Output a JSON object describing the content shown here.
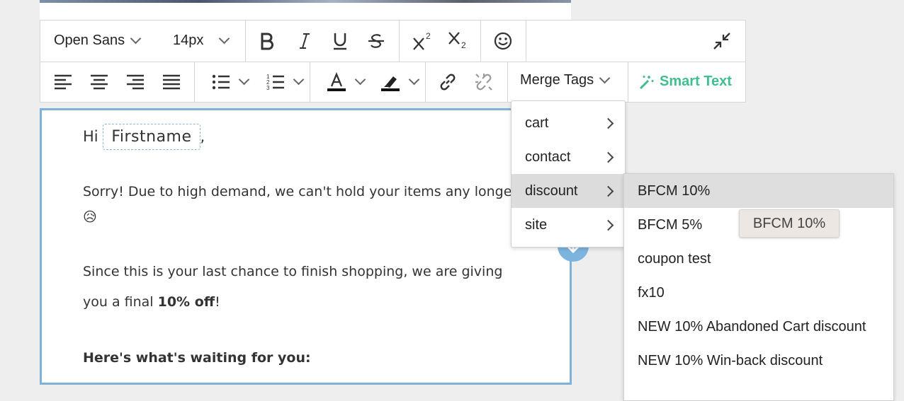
{
  "toolbar": {
    "font_family": "Open Sans",
    "font_size": "14px",
    "merge_tags_label": "Merge Tags",
    "smart_text_label": "Smart Text"
  },
  "editor": {
    "greeting_prefix": "Hi",
    "firstname_tag": "Firstname",
    "greeting_suffix": ",",
    "para1": "Sorry! Due to high demand, we can't hold your items any longe",
    "emoji": "😥",
    "para2_line1": "Since this is your last chance to finish shopping, we are giving",
    "para2_line2_prefix": "you a final ",
    "para2_bold": "10% off",
    "para2_suffix": "!",
    "heading": "Here's what's waiting for you:"
  },
  "merge_menu": {
    "items": [
      {
        "label": "cart"
      },
      {
        "label": "contact"
      },
      {
        "label": "discount"
      },
      {
        "label": "site"
      }
    ]
  },
  "discount_menu": {
    "items": [
      {
        "label": "BFCM 10%"
      },
      {
        "label": "BFCM 5%"
      },
      {
        "label": "coupon test"
      },
      {
        "label": "fx10"
      },
      {
        "label": "NEW 10% Abandoned Cart discount"
      },
      {
        "label": "NEW 10% Win-back discount"
      }
    ]
  },
  "tooltip": "BFCM 10%",
  "colors": {
    "accent_green": "#3fbf8f",
    "editor_border": "#7fb1da",
    "active_item": "#dcdcdc"
  }
}
